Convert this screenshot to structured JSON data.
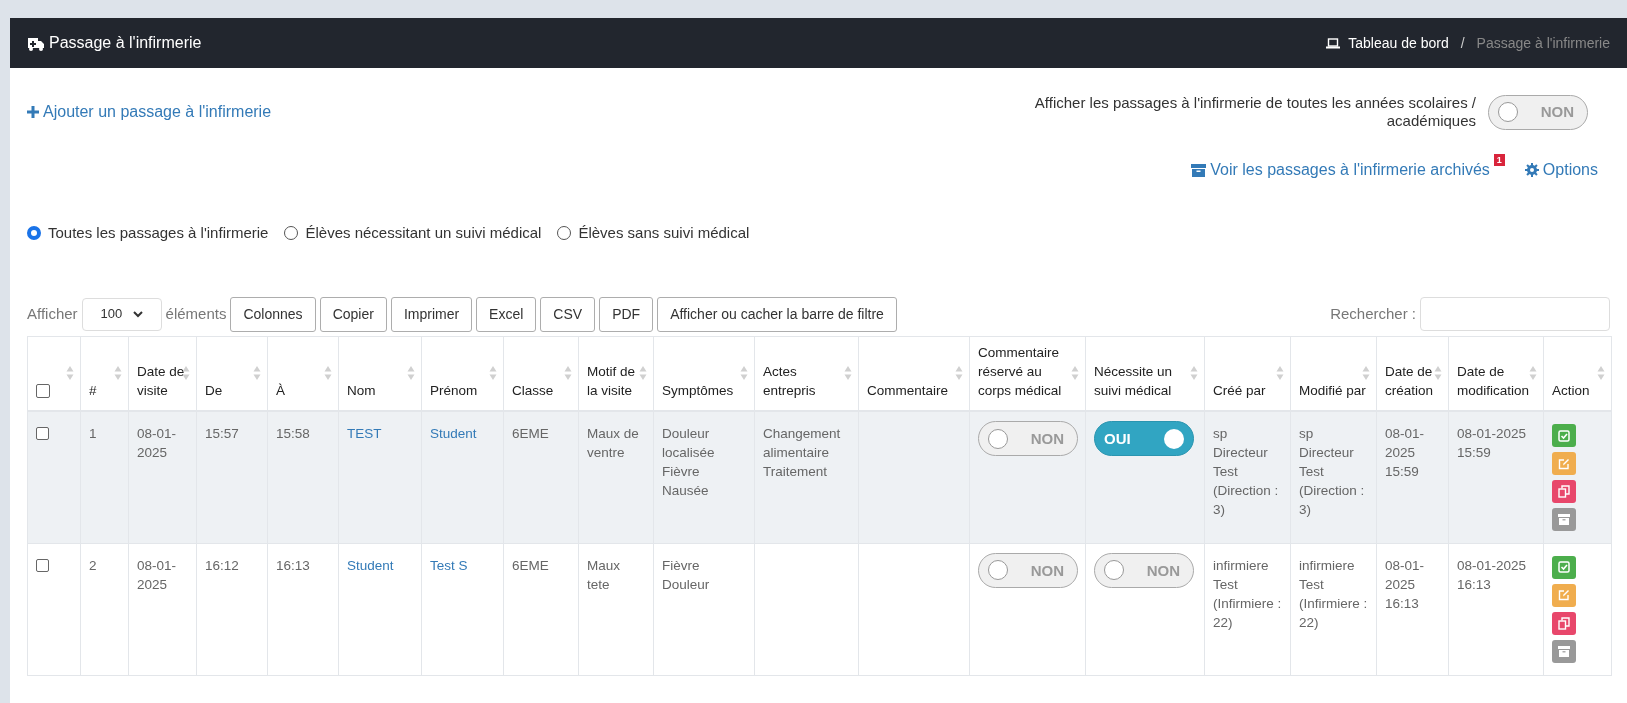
{
  "header": {
    "title": "Passage à l'infirmerie",
    "breadcrumb_separator": "/",
    "breadcrumb": [
      {
        "label": "Tableau de bord",
        "kind": "link"
      },
      {
        "label": "Passage à l'infirmerie",
        "kind": "current"
      }
    ]
  },
  "add_link": "Ajouter un passage à l'infirmerie",
  "all_years": {
    "label": "Afficher les passages à l'infirmerie de toutes les années scolaires / académiques",
    "on": false,
    "state_label": "NON"
  },
  "archived_link": {
    "label": "Voir les passages à l'infirmerie archivés",
    "badge": "1"
  },
  "options_link": "Options",
  "filters": [
    {
      "label": "Toutes les passages à l'infirmerie",
      "selected": true
    },
    {
      "label": "Élèves nécessitant un suivi médical",
      "selected": false
    },
    {
      "label": "Élèves sans suivi médical",
      "selected": false
    }
  ],
  "length": {
    "prefix": "Afficher",
    "value": "100",
    "suffix": "éléments"
  },
  "buttons": [
    "Colonnes",
    "Copier",
    "Imprimer",
    "Excel",
    "CSV",
    "PDF",
    "Afficher ou cacher la barre de filtre"
  ],
  "search": {
    "label": "Rechercher :"
  },
  "table": {
    "select_all": {
      "checked": false
    },
    "columns": [
      "#",
      "Date de visite",
      "De",
      "À",
      "Nom",
      "Prénom",
      "Classe",
      "Motif de la visite",
      "Symptômes",
      "Actes entrepris",
      "Commentaire",
      "Commentaire réservé au corps médical",
      "Nécessite un suivi médical",
      "Créé par",
      "Modifié par",
      "Date de création",
      "Date de modification",
      "Action"
    ],
    "rows": [
      {
        "checked": false,
        "highlighted": true,
        "number": "1",
        "visit_date": "08-01-2025",
        "from": "15:57",
        "to": "15:58",
        "last_name": "TEST",
        "first_name": "Student",
        "class": "6EME",
        "reason": "Maux de ventre",
        "symptoms": [
          "Douleur localisée",
          "Fièvre",
          "Nausée"
        ],
        "actions_taken": [
          "Changement alimentaire",
          "Traitement"
        ],
        "comment_reserved": {
          "on": false,
          "label": "NON"
        },
        "follow_up": {
          "on": true,
          "label": "OUI"
        },
        "created_by": "sp Directeur Test (Direction : 3)",
        "modified_by": "sp Directeur Test (Direction : 3)",
        "created_at": "08-01-2025 15:59",
        "modified_at": "08-01-2025 15:59"
      },
      {
        "checked": false,
        "highlighted": false,
        "number": "2",
        "visit_date": "08-01-2025",
        "from": "16:12",
        "to": "16:13",
        "last_name": "Student",
        "first_name": "Test S",
        "class": "6EME",
        "reason": "Maux tete",
        "symptoms": [
          "Fièvre",
          "Douleur"
        ],
        "actions_taken": [],
        "comment_reserved": {
          "on": false,
          "label": "NON"
        },
        "follow_up": {
          "on": false,
          "label": "NON"
        },
        "created_by": "infirmiere Test (Infirmiere : 22)",
        "modified_by": "infirmiere Test (Infirmiere : 22)",
        "created_at": "08-01-2025 16:13",
        "modified_at": "08-01-2025 16:13"
      }
    ]
  }
}
